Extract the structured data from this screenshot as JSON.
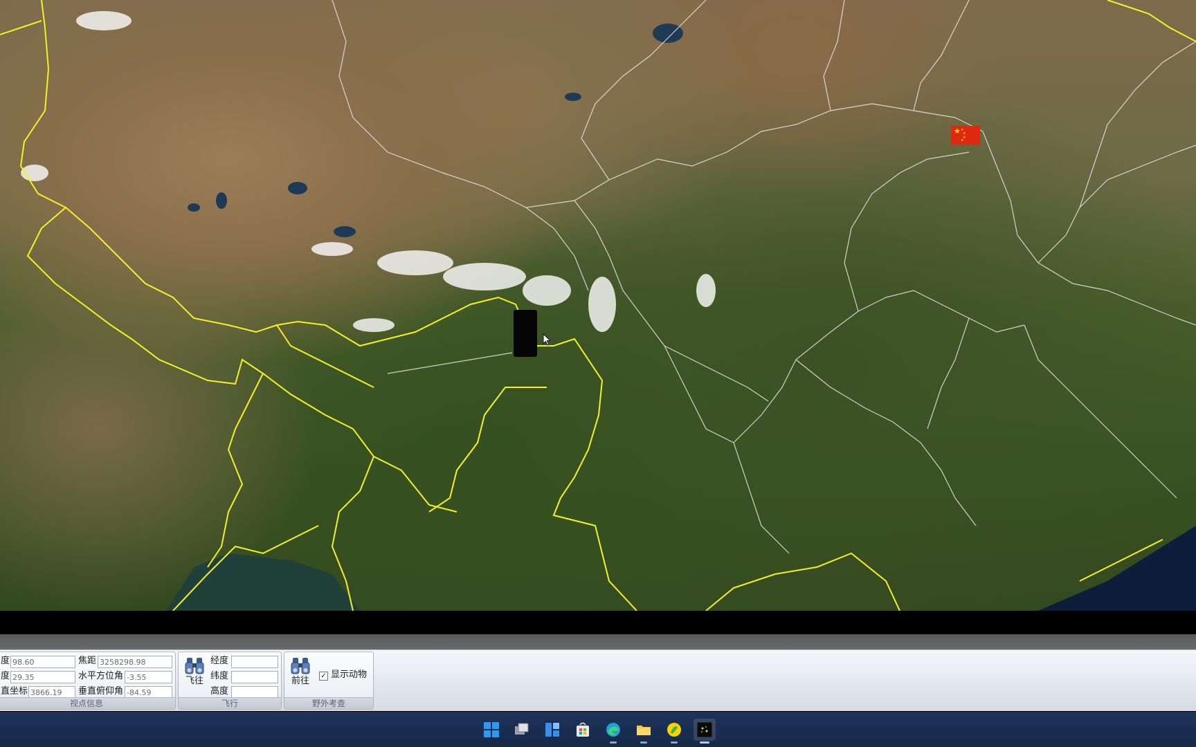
{
  "colors": {
    "border_yellow": "#f2f226",
    "border_white": "#e8e8e8",
    "ribbon_bg": "#e3e7ee",
    "taskbar_bg": "#1a2e52"
  },
  "map": {
    "flag_icon": "china-flag-icon"
  },
  "viewpoint_group": {
    "title": "视点信息",
    "row1_label": "度",
    "row1_value": "98.60",
    "row2_label": "度",
    "row2_value": "29.35",
    "row3_label": "直坐标",
    "row3_value": "3866.19",
    "focal_label": "焦距",
    "focal_value": "3258298.98",
    "azimuth_label": "水平方位角",
    "azimuth_value": "-3.55",
    "pitch_label": "垂直俯仰角",
    "pitch_value": "-84.59"
  },
  "fly_group": {
    "title": "飞行",
    "button_label": "飞往",
    "lon_label": "经度",
    "lat_label": "纬度",
    "alt_label": "高度",
    "lon_value": "",
    "lat_value": "",
    "alt_value": ""
  },
  "field_group": {
    "title": "野外考查",
    "button_label": "前往",
    "checkbox_label": "显示动物",
    "checkbox_checked": true,
    "checkbox_mark": "✓"
  },
  "taskbar": {
    "icons": [
      "windows-start-icon",
      "task-view-icon",
      "widgets-icon",
      "store-icon",
      "edge-browser-icon",
      "file-explorer-icon",
      "app-icon",
      "globe-app-icon"
    ]
  }
}
